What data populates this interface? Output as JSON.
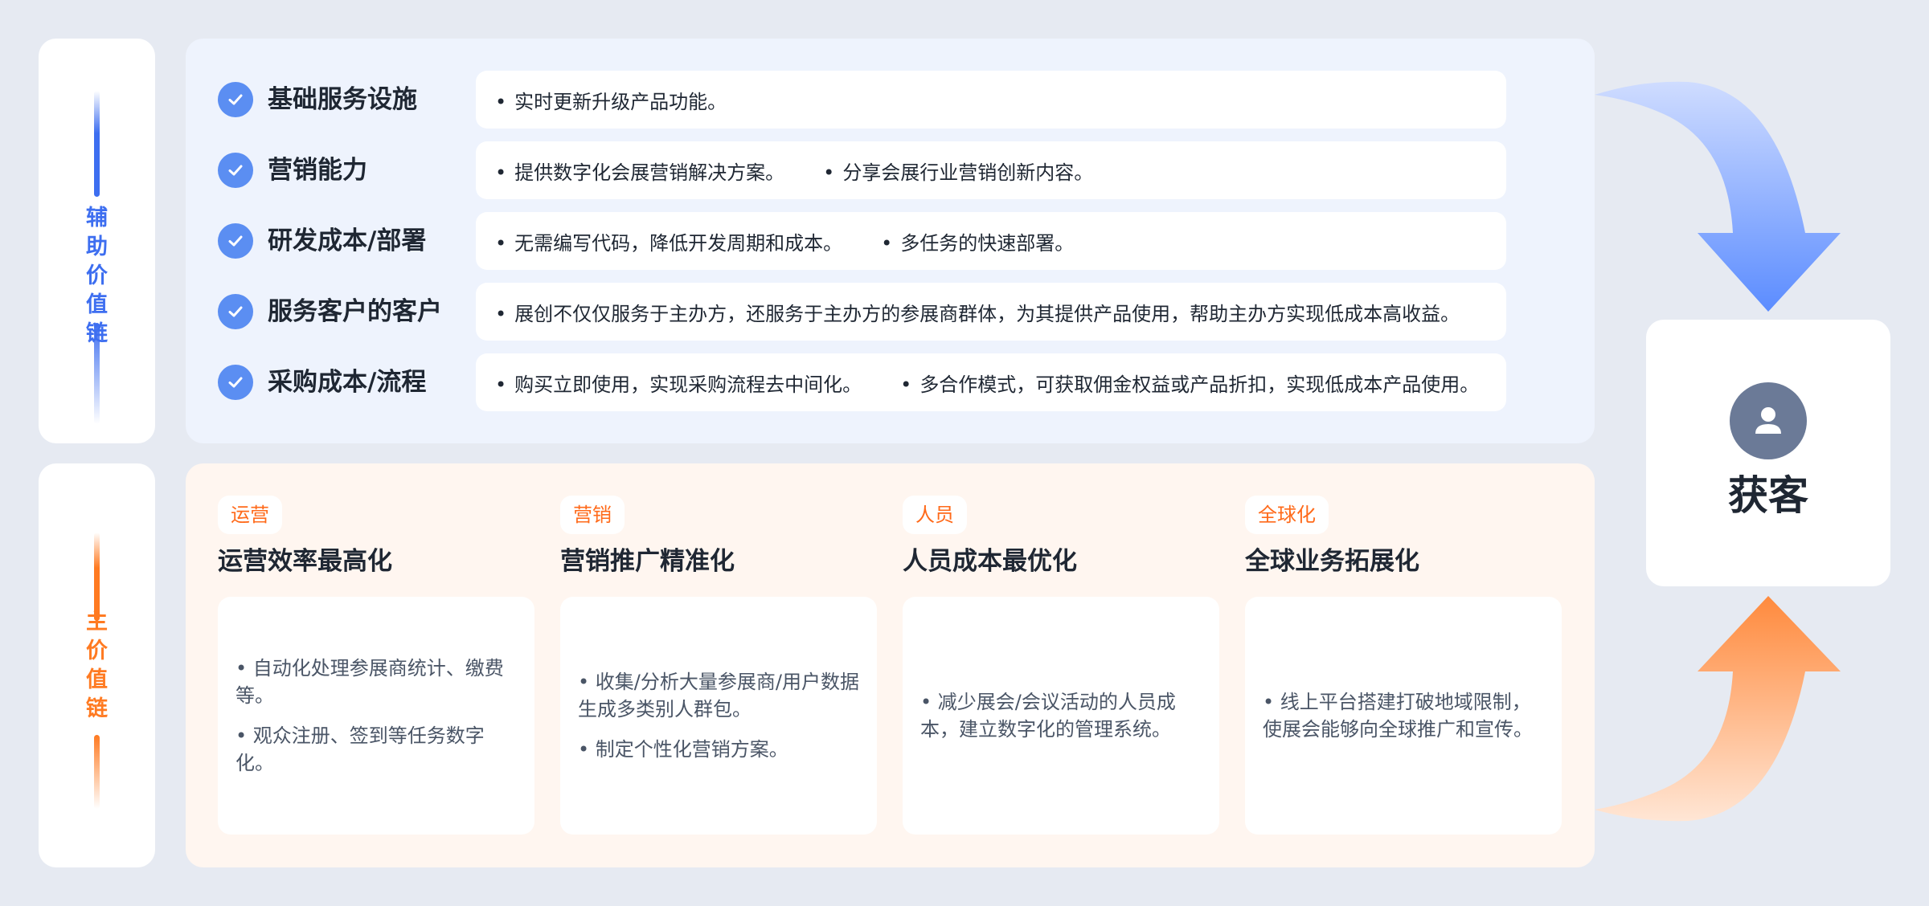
{
  "side": {
    "top_label": [
      "辅",
      "助",
      "价",
      "值",
      "链"
    ],
    "bottom_label": [
      "主",
      "价",
      "值",
      "链"
    ]
  },
  "support_rows": [
    {
      "title": "基础服务设施",
      "points": [
        "实时更新升级产品功能。"
      ]
    },
    {
      "title": "营销能力",
      "points": [
        "提供数字化会展营销解决方案。",
        "分享会展行业营销创新内容。"
      ]
    },
    {
      "title": "研发成本/部署",
      "points": [
        "无需编写代码，降低开发周期和成本。",
        "多任务的快速部署。"
      ]
    },
    {
      "title": "服务客户的客户",
      "points": [
        "展创不仅仅服务于主办方，还服务于主办方的参展商群体，为其提供产品使用，帮助主办方实现低成本高收益。"
      ]
    },
    {
      "title": "采购成本/流程",
      "points": [
        "购买立即使用，实现采购流程去中间化。",
        "多合作模式，可获取佣金权益或产品折扣，实现低成本产品使用。"
      ]
    }
  ],
  "main_columns": [
    {
      "tag": "运营",
      "title": "运营效率最高化",
      "points": [
        "自动化处理参展商统计、缴费等。",
        "观众注册、签到等任务数字化。"
      ]
    },
    {
      "tag": "营销",
      "title": "营销推广精准化",
      "points": [
        "收集/分析大量参展商/用户数据生成多类别人群包。",
        "制定个性化营销方案。"
      ]
    },
    {
      "tag": "人员",
      "title": "人员成本最优化",
      "points": [
        "减少展会/会议活动的人员成本，建立数字化的管理系统。"
      ]
    },
    {
      "tag": "全球化",
      "title": "全球业务拓展化",
      "points": [
        "线上平台搭建打破地域限制，使展会能够向全球推广和宣传。"
      ]
    }
  ],
  "customer": {
    "label": "获客",
    "icon": "user-icon"
  },
  "colors": {
    "blue": "#3d6ef0",
    "orange": "#ff7a21",
    "check": "#5b8ef2"
  }
}
